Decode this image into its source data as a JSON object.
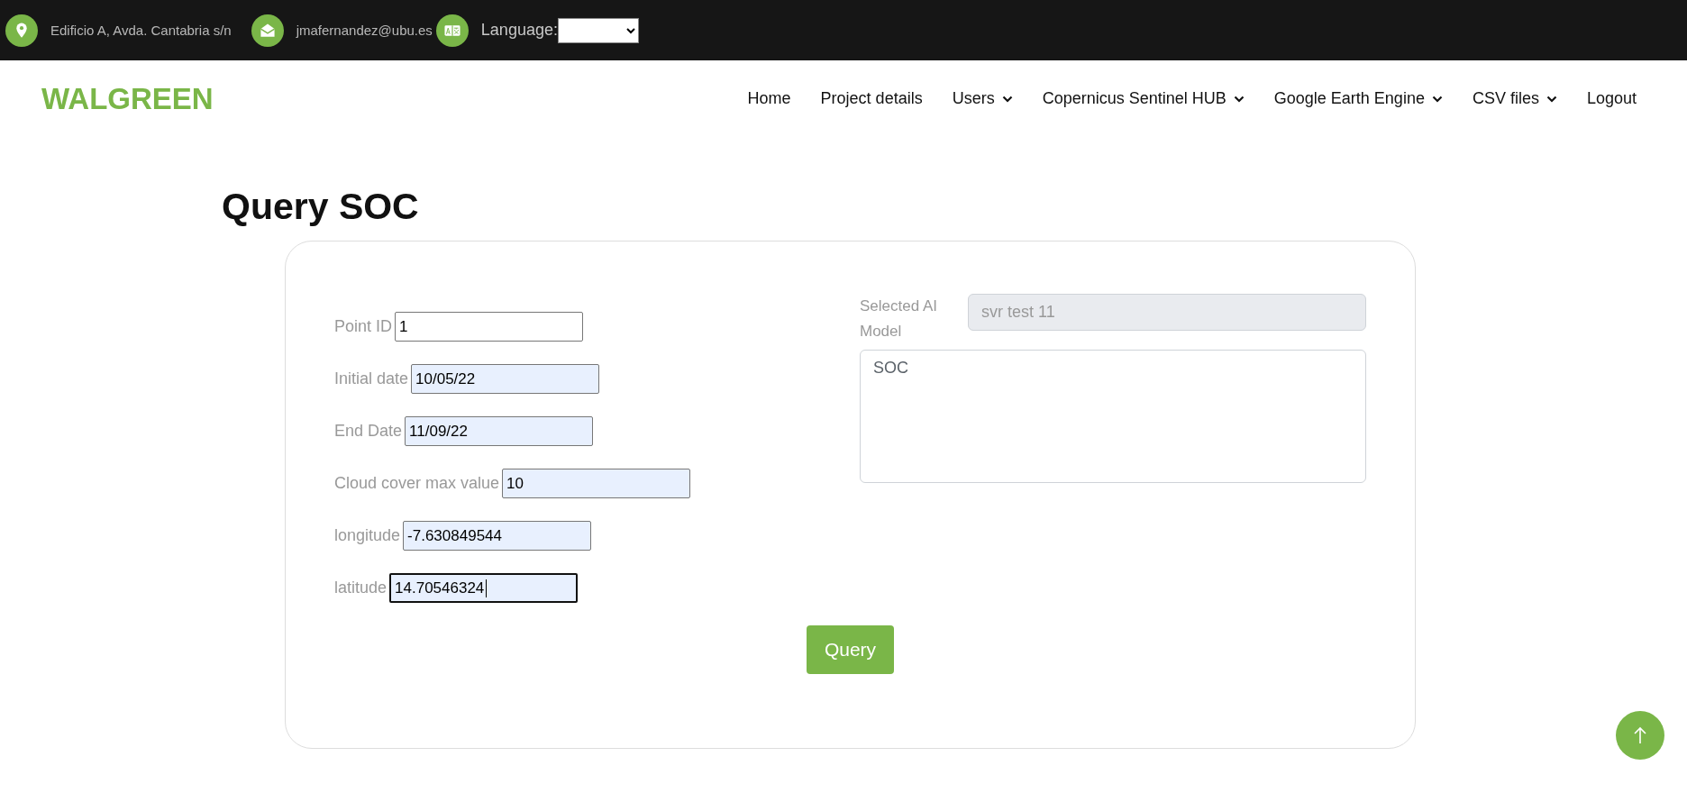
{
  "topbar": {
    "address": "Edificio A, Avda. Cantabria s/n",
    "email": "jmafernandez@ubu.es",
    "language_label": "Language:"
  },
  "navbar": {
    "logo": "WALGREEN",
    "items": [
      {
        "label": "Home",
        "dropdown": false
      },
      {
        "label": "Project details",
        "dropdown": false
      },
      {
        "label": "Users",
        "dropdown": true
      },
      {
        "label": "Copernicus Sentinel HUB",
        "dropdown": true
      },
      {
        "label": "Google Earth Engine",
        "dropdown": true
      },
      {
        "label": "CSV files",
        "dropdown": true
      },
      {
        "label": "Logout",
        "dropdown": false
      }
    ]
  },
  "page_title": "Query SOC",
  "form": {
    "fields": [
      {
        "label": "Point ID",
        "value": "1",
        "autofilled": false,
        "focused": false
      },
      {
        "label": "Initial date",
        "value": "10/05/22",
        "autofilled": true,
        "focused": false
      },
      {
        "label": "End Date",
        "value": "11/09/22",
        "autofilled": true,
        "focused": false
      },
      {
        "label": "Cloud cover max value",
        "value": "10",
        "autofilled": true,
        "focused": false
      },
      {
        "label": "longitude",
        "value": "-7.630849544",
        "autofilled": true,
        "focused": false
      },
      {
        "label": "latitude",
        "value": "14.70546324",
        "autofilled": true,
        "focused": true
      }
    ],
    "model_label": "Selected AI Model",
    "model_value": "svr test 11",
    "result": "SOC",
    "submit": "Query"
  }
}
